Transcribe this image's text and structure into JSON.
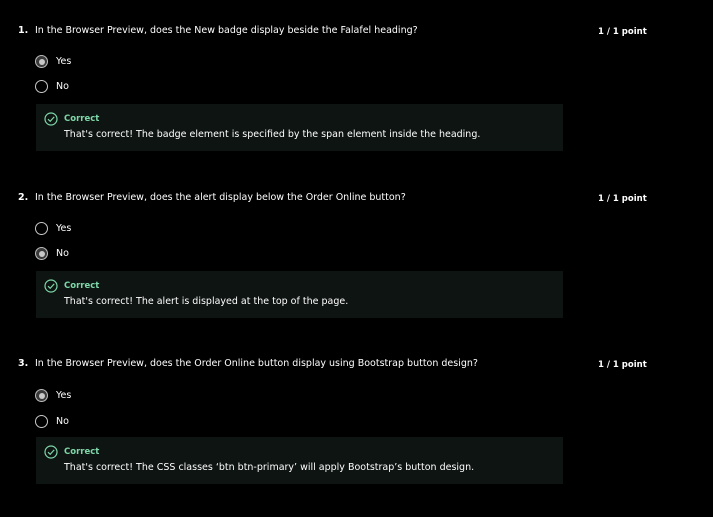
{
  "colors": {
    "background": "#000000",
    "text": "#ffffff",
    "feedback_bg": "#0e1412",
    "correct_green": "#7ed7a8",
    "radio": "#c8c8c8"
  },
  "questions": [
    {
      "number": "1.",
      "text": "In the Browser Preview, does the New badge display beside the Falafel heading?",
      "points": "1 / 1 point",
      "options": [
        {
          "label": "Yes",
          "selected": true
        },
        {
          "label": "No",
          "selected": false
        }
      ],
      "feedback": {
        "icon": "check-circle-icon",
        "status": "Correct",
        "text": "That's correct! The badge element is specified by the span element inside the heading."
      }
    },
    {
      "number": "2.",
      "text": "In the Browser Preview, does the alert display below the Order Online button?",
      "points": "1 / 1 point",
      "options": [
        {
          "label": "Yes",
          "selected": false
        },
        {
          "label": "No",
          "selected": true
        }
      ],
      "feedback": {
        "icon": "check-circle-icon",
        "status": "Correct",
        "text": "That's correct! The alert is displayed at the top of the page."
      }
    },
    {
      "number": "3.",
      "text": "In the Browser Preview, does the Order Online button display using Bootstrap button design?",
      "points": "1 / 1 point",
      "options": [
        {
          "label": "Yes",
          "selected": true
        },
        {
          "label": "No",
          "selected": false
        }
      ],
      "feedback": {
        "icon": "check-circle-icon",
        "status": "Correct",
        "text": "That's correct! The CSS classes ‘btn btn-primary’ will apply Bootstrap’s button design."
      }
    }
  ]
}
